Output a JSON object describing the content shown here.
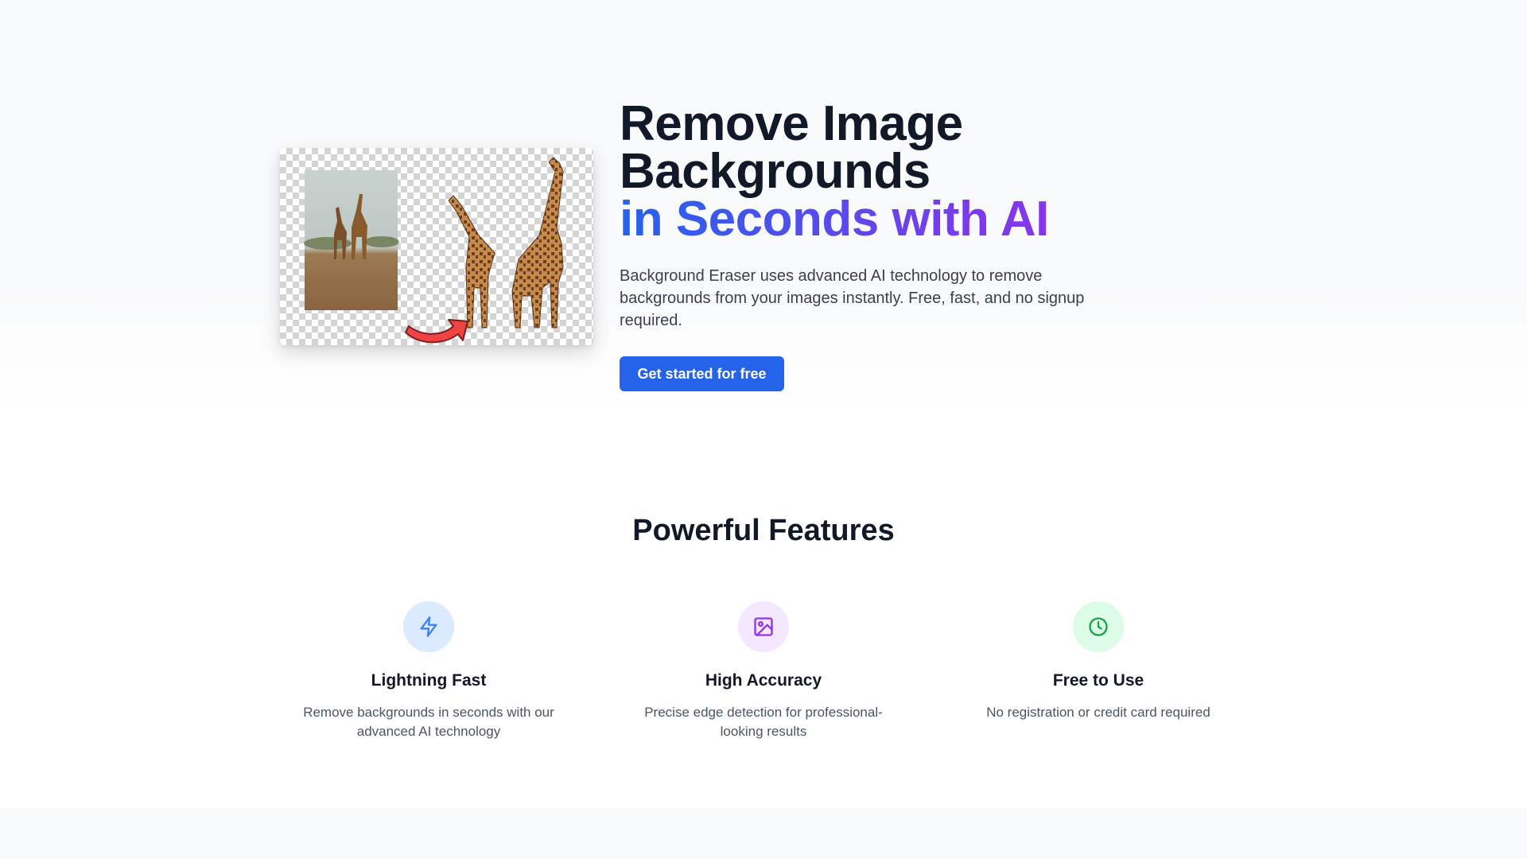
{
  "hero": {
    "title_line1": "Remove Image",
    "title_line2": "Backgrounds",
    "title_highlight": "in Seconds with AI",
    "description": "Background Eraser uses advanced AI technology to remove backgrounds from your images instantly. Free, fast, and no signup required.",
    "cta_label": "Get started for free",
    "image_icon": "giraffe-before-after-illustration",
    "colors": {
      "cta": "#2563eb",
      "gradient_start": "#2563eb",
      "gradient_end": "#9333ea",
      "arrow": "#ef4444"
    }
  },
  "features": {
    "title": "Powerful Features",
    "items": [
      {
        "icon": "lightning-icon",
        "icon_color": "#3b82f6",
        "icon_bg": "#dbeafe",
        "title": "Lightning Fast",
        "description": "Remove backgrounds in seconds with our advanced AI technology"
      },
      {
        "icon": "image-icon",
        "icon_color": "#9333ea",
        "icon_bg": "#f3e8ff",
        "title": "High Accuracy",
        "description": "Precise edge detection for professional-looking results"
      },
      {
        "icon": "clock-icon",
        "icon_color": "#16a34a",
        "icon_bg": "#dcfce7",
        "title": "Free to Use",
        "description": "No registration or credit card required"
      }
    ]
  }
}
